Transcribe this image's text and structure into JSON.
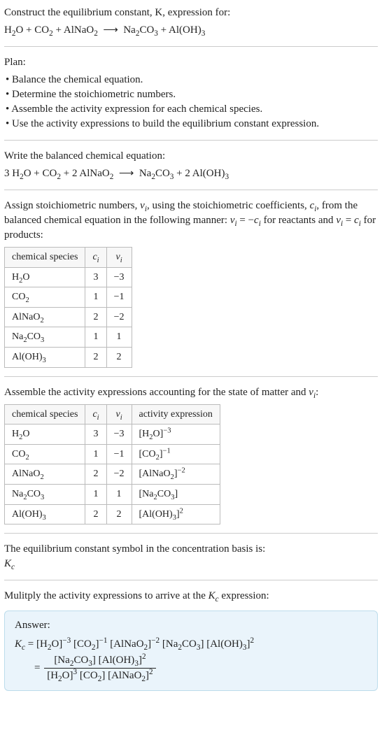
{
  "intro": {
    "heading": "Construct the equilibrium constant, K, expression for:",
    "equation_html": "H<sub>2</sub>O + CO<sub>2</sub> + AlNaO<sub>2</sub> &nbsp;⟶&nbsp; Na<sub>2</sub>CO<sub>3</sub> + Al(OH)<sub>3</sub>"
  },
  "plan": {
    "heading": "Plan:",
    "items": [
      "Balance the chemical equation.",
      "Determine the stoichiometric numbers.",
      "Assemble the activity expression for each chemical species.",
      "Use the activity expressions to build the equilibrium constant expression."
    ]
  },
  "balanced": {
    "heading": "Write the balanced chemical equation:",
    "equation_html": "3 H<sub>2</sub>O + CO<sub>2</sub> + 2 AlNaO<sub>2</sub> &nbsp;⟶&nbsp; Na<sub>2</sub>CO<sub>3</sub> + 2 Al(OH)<sub>3</sub>"
  },
  "stoich": {
    "heading_html": "Assign stoichiometric numbers, <span class='sym'>ν<sub>i</sub></span>, using the stoichiometric coefficients, <span class='sym'>c<sub>i</sub></span>, from the balanced chemical equation in the following manner: <span class='sym'>ν<sub>i</sub></span> = −<span class='sym'>c<sub>i</sub></span> for reactants and <span class='sym'>ν<sub>i</sub></span> = <span class='sym'>c<sub>i</sub></span> for products:",
    "headers": {
      "species": "chemical species",
      "ci_html": "<span class='sym'>c<sub>i</sub></span>",
      "vi_html": "<span class='sym'>ν<sub>i</sub></span>"
    },
    "rows": [
      {
        "species_html": "H<sub>2</sub>O",
        "ci": "3",
        "vi": "−3"
      },
      {
        "species_html": "CO<sub>2</sub>",
        "ci": "1",
        "vi": "−1"
      },
      {
        "species_html": "AlNaO<sub>2</sub>",
        "ci": "2",
        "vi": "−2"
      },
      {
        "species_html": "Na<sub>2</sub>CO<sub>3</sub>",
        "ci": "1",
        "vi": "1"
      },
      {
        "species_html": "Al(OH)<sub>3</sub>",
        "ci": "2",
        "vi": "2"
      }
    ]
  },
  "activity": {
    "heading_html": "Assemble the activity expressions accounting for the state of matter and <span class='sym'>ν<sub>i</sub></span>:",
    "headers": {
      "species": "chemical species",
      "ci_html": "<span class='sym'>c<sub>i</sub></span>",
      "vi_html": "<span class='sym'>ν<sub>i</sub></span>",
      "activity": "activity expression"
    },
    "rows": [
      {
        "species_html": "H<sub>2</sub>O",
        "ci": "3",
        "vi": "−3",
        "act_html": "[H<sub>2</sub>O]<sup>−3</sup>"
      },
      {
        "species_html": "CO<sub>2</sub>",
        "ci": "1",
        "vi": "−1",
        "act_html": "[CO<sub>2</sub>]<sup>−1</sup>"
      },
      {
        "species_html": "AlNaO<sub>2</sub>",
        "ci": "2",
        "vi": "−2",
        "act_html": "[AlNaO<sub>2</sub>]<sup>−2</sup>"
      },
      {
        "species_html": "Na<sub>2</sub>CO<sub>3</sub>",
        "ci": "1",
        "vi": "1",
        "act_html": "[Na<sub>2</sub>CO<sub>3</sub>]"
      },
      {
        "species_html": "Al(OH)<sub>3</sub>",
        "ci": "2",
        "vi": "2",
        "act_html": "[Al(OH)<sub>3</sub>]<sup>2</sup>"
      }
    ]
  },
  "kc_symbol": {
    "line1": "The equilibrium constant symbol in the concentration basis is:",
    "line2_html": "<span class='sym'>K<sub>c</sub></span>"
  },
  "multiply": {
    "heading_html": "Mulitply the activity expressions to arrive at the <span class='sym'>K<sub>c</sub></span> expression:"
  },
  "answer": {
    "label": "Answer:",
    "line1_html": "<span class='sym'>K<sub>c</sub></span> = [H<sub>2</sub>O]<sup>−3</sup> [CO<sub>2</sub>]<sup>−1</sup> [AlNaO<sub>2</sub>]<sup>−2</sup> [Na<sub>2</sub>CO<sub>3</sub>] [Al(OH)<sub>3</sub>]<sup>2</sup>",
    "frac_num_html": "[Na<sub>2</sub>CO<sub>3</sub>] [Al(OH)<sub>3</sub>]<sup>2</sup>",
    "frac_den_html": "[H<sub>2</sub>O]<sup>3</sup> [CO<sub>2</sub>] [AlNaO<sub>2</sub>]<sup>2</sup>"
  }
}
